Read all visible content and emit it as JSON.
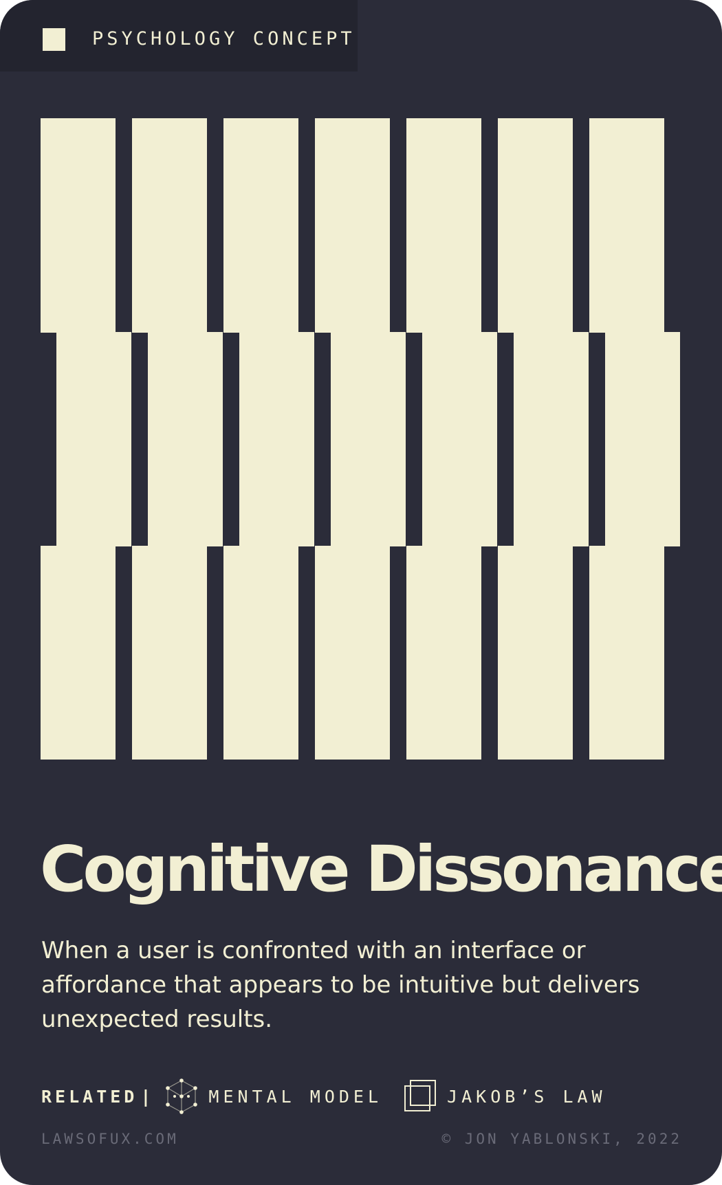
{
  "card": {
    "category_label": "PSYCHOLOGY CONCEPT",
    "title": "Cognitive Dissonance",
    "description": "When a user is confronted with an interface or affordance that appears to be intuitive but delivers unexpected results.",
    "related": {
      "label": "RELATED",
      "separator": "|",
      "items": [
        {
          "label": "MENTAL MODEL",
          "icon": "cube-dots-icon"
        },
        {
          "label": "JAKOB’S LAW",
          "icon": "stacked-squares-icon"
        }
      ]
    },
    "footer": {
      "site": "LAWSOFUX.COM",
      "credit": "© JON YABLONSKI, 2022"
    }
  },
  "colors": {
    "background": "#2b2c39",
    "tag_background": "#23242f",
    "accent": "#f2efd3",
    "muted": "#6a6b78"
  },
  "graphic": {
    "icon": "offset-bars-pattern",
    "rows": 3,
    "bars_per_row": 7
  }
}
